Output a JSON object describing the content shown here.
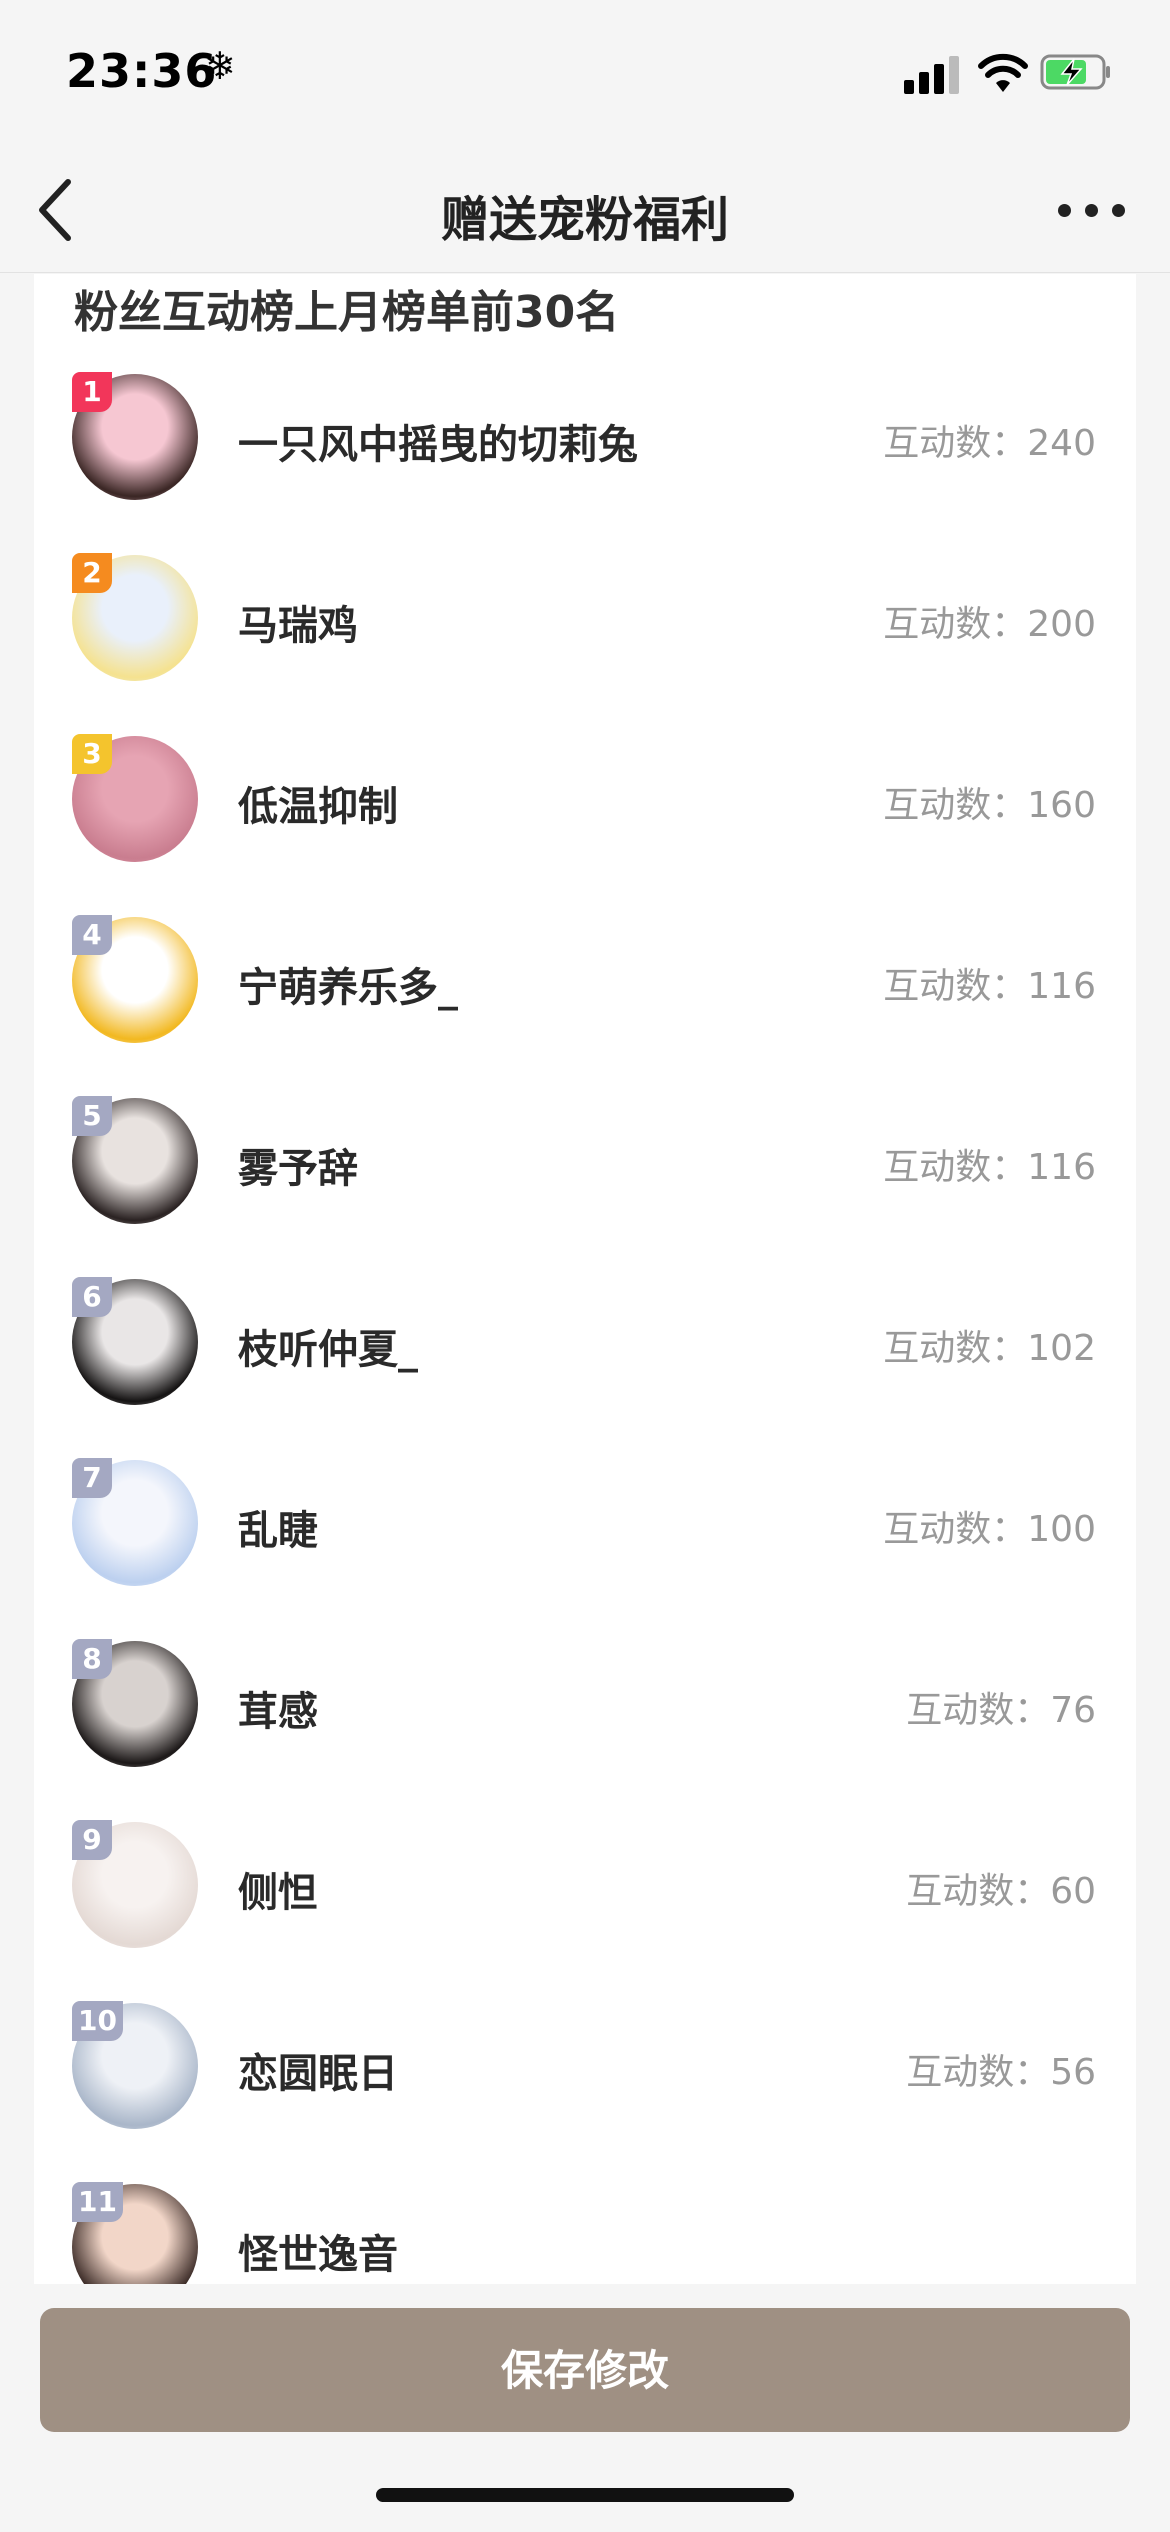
{
  "status_bar": {
    "time": "23:36",
    "snow_glyph": "❄"
  },
  "nav": {
    "title": "赠送宠粉福利",
    "back_icon": "chevron-left-icon",
    "more_icon": "more-dots-icon"
  },
  "section": {
    "title": "粉丝互动榜上月榜单前30名"
  },
  "fans": [
    {
      "rank": "1",
      "name": "一只风中摇曳的切莉兔",
      "count": "互动数：240",
      "badge": "#f2365a",
      "avatar": [
        "#f6c7d2",
        "#3a2624"
      ]
    },
    {
      "rank": "2",
      "name": "马瑞鸡",
      "count": "互动数：200",
      "badge": "#f58b1f",
      "avatar": [
        "#e9f0fb",
        "#f5e28f"
      ]
    },
    {
      "rank": "3",
      "name": "低温抑制",
      "count": "互动数：160",
      "badge": "#f4c42d",
      "avatar": [
        "#e6a4b3",
        "#c97d8f"
      ]
    },
    {
      "rank": "4",
      "name": "宁萌养乐多_",
      "count": "互动数：116",
      "badge": "#a4a8c2",
      "avatar": [
        "#ffffff",
        "#f2b820"
      ]
    },
    {
      "rank": "5",
      "name": "雾予辞",
      "count": "互动数：116",
      "badge": "#a4a8c2",
      "avatar": [
        "#e8e2df",
        "#2a2222"
      ]
    },
    {
      "rank": "6",
      "name": "枝听仲夏_",
      "count": "互动数：102",
      "badge": "#a4a8c2",
      "avatar": [
        "#e9e6e6",
        "#151313"
      ]
    },
    {
      "rank": "7",
      "name": "乱睫",
      "count": "互动数：100",
      "badge": "#a4a8c2",
      "avatar": [
        "#f4f6fc",
        "#bcd0ef"
      ]
    },
    {
      "rank": "8",
      "name": "茸感",
      "count": "互动数：76",
      "badge": "#a4a8c2",
      "avatar": [
        "#d8d2cf",
        "#1c1818"
      ]
    },
    {
      "rank": "9",
      "name": "侧怛",
      "count": "互动数：60",
      "badge": "#a4a8c2",
      "avatar": [
        "#f7f2f0",
        "#e4d9d4"
      ]
    },
    {
      "rank": "10",
      "name": "恋圆眠日",
      "count": "互动数：56",
      "badge": "#a4a8c2",
      "avatar": [
        "#eef1f6",
        "#a9b6c9"
      ]
    },
    {
      "rank": "11",
      "name": "怪世逸音",
      "count": "",
      "badge": "#a4a8c2",
      "avatar": [
        "#f2d6c8",
        "#3a2a26"
      ]
    }
  ],
  "footer": {
    "save_label": "保存修改"
  }
}
